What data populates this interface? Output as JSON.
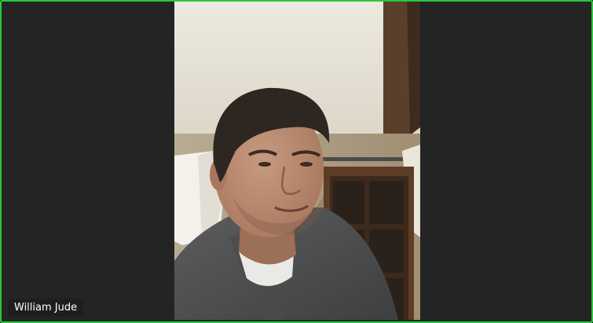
{
  "participant": {
    "name": "William Jude",
    "active_speaker_color": "#27c93f"
  }
}
